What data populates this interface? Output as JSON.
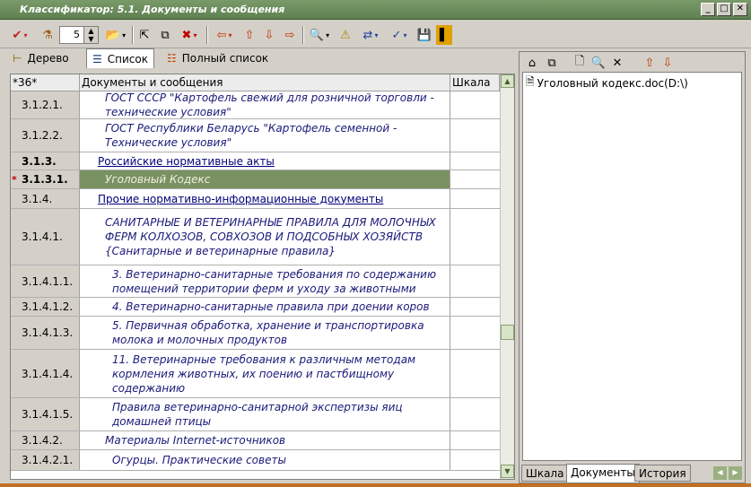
{
  "window": {
    "title": "Классификатор: 5.1. Документы и сообщения",
    "minimize": "_",
    "maximize": "□",
    "close": "✕"
  },
  "toolbar": {
    "level_value": "5",
    "icons": [
      "checkmark-icon",
      "filter-icon",
      "open-folder-icon",
      "move-icon",
      "copy-icon",
      "delete-icon",
      "arrow-left-icon",
      "arrow-up-icon",
      "arrow-down-icon",
      "arrow-right-icon",
      "preview-icon",
      "warning-icon",
      "export-icon",
      "spellcheck-icon",
      "save-icon",
      "book-icon"
    ]
  },
  "view_tabs": [
    {
      "label": "Дерево",
      "active": false
    },
    {
      "label": "Список",
      "active": true
    },
    {
      "label": "Полный список",
      "active": false
    }
  ],
  "grid": {
    "headers": [
      "*36*",
      "Документы и сообщения",
      "Шкала"
    ],
    "rows": [
      {
        "code": "3.1.2.1.",
        "text": "ГОСТ СССР \"Картофель свежий для розничной торговли - технические условия\"",
        "style": "italic",
        "indent": 28,
        "bold": false
      },
      {
        "code": "3.1.2.2.",
        "text": "ГОСТ Республики Беларусь \"Картофель семенной - Технические условия\"",
        "style": "italic",
        "indent": 28,
        "bold": false
      },
      {
        "code": "3.1.3.",
        "text": "Российские нормативные акты",
        "style": "link",
        "indent": 20,
        "bold": true
      },
      {
        "code": "3.1.3.1.",
        "text": "Уголовный Кодекс",
        "style": "selected",
        "indent": 28,
        "bold": true,
        "marker": "*"
      },
      {
        "code": "3.1.4.",
        "text": "Прочие нормативно-информационные документы",
        "style": "link",
        "indent": 20,
        "bold": false
      },
      {
        "code": "3.1.4.1.",
        "text": "САНИТАРНЫЕ И ВЕТЕРИНАРНЫЕ ПРАВИЛА ДЛЯ МОЛОЧНЫХ ФЕРМ КОЛХОЗОВ, СОВХОЗОВ И ПОДСОБНЫХ ХОЗЯЙСТВ {Санитарные и ветеринарные правила}",
        "style": "italic",
        "indent": 28,
        "bold": false
      },
      {
        "code": "3.1.4.1.1.",
        "text": "3. Ветеринарно-санитарные требования по содержанию помещений территории ферм и уходу за животными",
        "style": "italic",
        "indent": 36,
        "bold": false
      },
      {
        "code": "3.1.4.1.2.",
        "text": "4. Ветеринарно-санитарные правила при доении коров",
        "style": "italic",
        "indent": 36,
        "bold": false
      },
      {
        "code": "3.1.4.1.3.",
        "text": "5. Первичная обработка, хранение и транспортировка молока и молочных продуктов",
        "style": "italic",
        "indent": 36,
        "bold": false
      },
      {
        "code": "3.1.4.1.4.",
        "text": "11. Ветеринарные требования к различным методам кормления животных, их поению и пастбищному содержанию",
        "style": "italic",
        "indent": 36,
        "bold": false
      },
      {
        "code": "3.1.4.1.5.",
        "text": "Правила ветеринарно-санитарной экспертизы яиц домашней птицы",
        "style": "italic",
        "indent": 36,
        "bold": false
      },
      {
        "code": "3.1.4.2.",
        "text": "Материалы Internet-источников",
        "style": "italic",
        "indent": 28,
        "bold": false
      },
      {
        "code": "3.1.4.2.1.",
        "text": "Огурцы. Практические советы",
        "style": "italic",
        "indent": 36,
        "bold": false
      }
    ]
  },
  "right_panel": {
    "files": [
      "Уголовный кодекс.doc(D:\\)"
    ],
    "tabs": [
      {
        "label": "Шкала",
        "active": false
      },
      {
        "label": "Документы",
        "active": true
      },
      {
        "label": "История",
        "active": false
      }
    ]
  }
}
